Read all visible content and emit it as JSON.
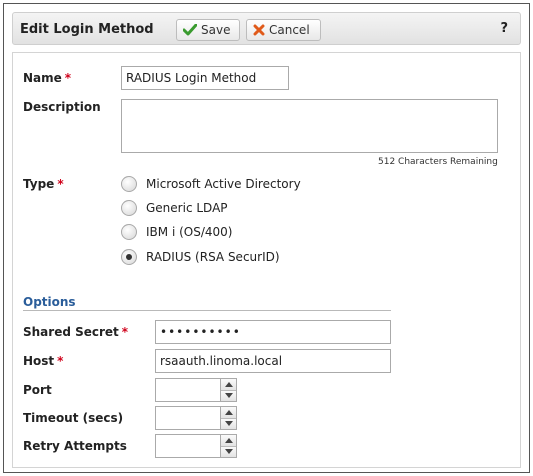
{
  "header": {
    "title": "Edit Login Method",
    "save_label": "Save",
    "cancel_label": "Cancel",
    "help_label": "?"
  },
  "form": {
    "name": {
      "label": "Name",
      "value": "RADIUS Login Method"
    },
    "description": {
      "label": "Description",
      "value": "",
      "remaining": "512 Characters Remaining"
    },
    "type": {
      "label": "Type",
      "options": [
        {
          "label": "Microsoft Active Directory",
          "checked": false
        },
        {
          "label": "Generic LDAP",
          "checked": false
        },
        {
          "label": "IBM i (OS/400)",
          "checked": false
        },
        {
          "label": "RADIUS (RSA SecurID)",
          "checked": true
        }
      ]
    }
  },
  "options": {
    "title": "Options",
    "shared_secret": {
      "label": "Shared Secret",
      "value": "••••••••••"
    },
    "host": {
      "label": "Host",
      "value": "rsaauth.linoma.local"
    },
    "port": {
      "label": "Port",
      "value": ""
    },
    "timeout": {
      "label": "Timeout (secs)",
      "value": ""
    },
    "retry": {
      "label": "Retry Attempts",
      "value": ""
    }
  },
  "colors": {
    "required": "#d0021b",
    "section": "#2a5d9a",
    "save_icon": "#3a9b2f",
    "cancel_icon": "#e05a1a"
  },
  "icons": {
    "save": "checkmark-icon",
    "cancel": "x-icon",
    "spin_up": "triangle-up-icon",
    "spin_down": "triangle-down-icon"
  }
}
